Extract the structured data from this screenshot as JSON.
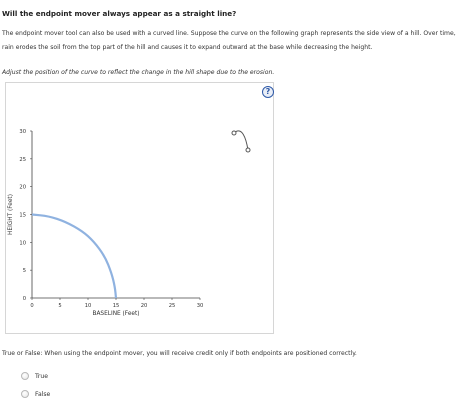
{
  "question": {
    "title": "Will the endpoint mover always appear as a straight line?",
    "paragraph_line1": "The endpoint mover tool can also be used with a curved line. Suppose the curve on the following graph represents the side view of a hill. Over time,",
    "paragraph_line2": "rain erodes the soil from the top part of the hill and causes it to expand outward at the base while decreasing the height.",
    "instruction": "Adjust the position of the curve to reflect the change in the hill shape due to the erosion."
  },
  "help_icon": {
    "label": "?",
    "icon": "question-icon",
    "color": "#2f5aa8"
  },
  "tool_icon": {
    "icon": "endpoint-mover-curve-icon"
  },
  "chart_data": {
    "type": "line",
    "xlabel": "BASELINE (Feet)",
    "ylabel": "HEIGHT (Feet)",
    "xlim": [
      0,
      30
    ],
    "ylim": [
      0,
      30
    ],
    "x_ticks": [
      0,
      5,
      10,
      15,
      20,
      25,
      30
    ],
    "y_ticks": [
      0,
      5,
      10,
      15,
      20,
      25,
      30
    ],
    "grid": false,
    "series": [
      {
        "color": "#8fb2e0",
        "points": [
          [
            0,
            15
          ],
          [
            3,
            14.7
          ],
          [
            6,
            13.7
          ],
          [
            9,
            12
          ],
          [
            11,
            10.2
          ],
          [
            13,
            7.5
          ],
          [
            14.2,
            4.5
          ],
          [
            14.8,
            2
          ],
          [
            15,
            0
          ]
        ]
      }
    ]
  },
  "true_false": {
    "question": "True or False: When using the endpoint mover, you will receive credit only if both endpoints are positioned correctly.",
    "options": [
      {
        "label": "True",
        "selected": false
      },
      {
        "label": "False",
        "selected": false
      }
    ]
  }
}
